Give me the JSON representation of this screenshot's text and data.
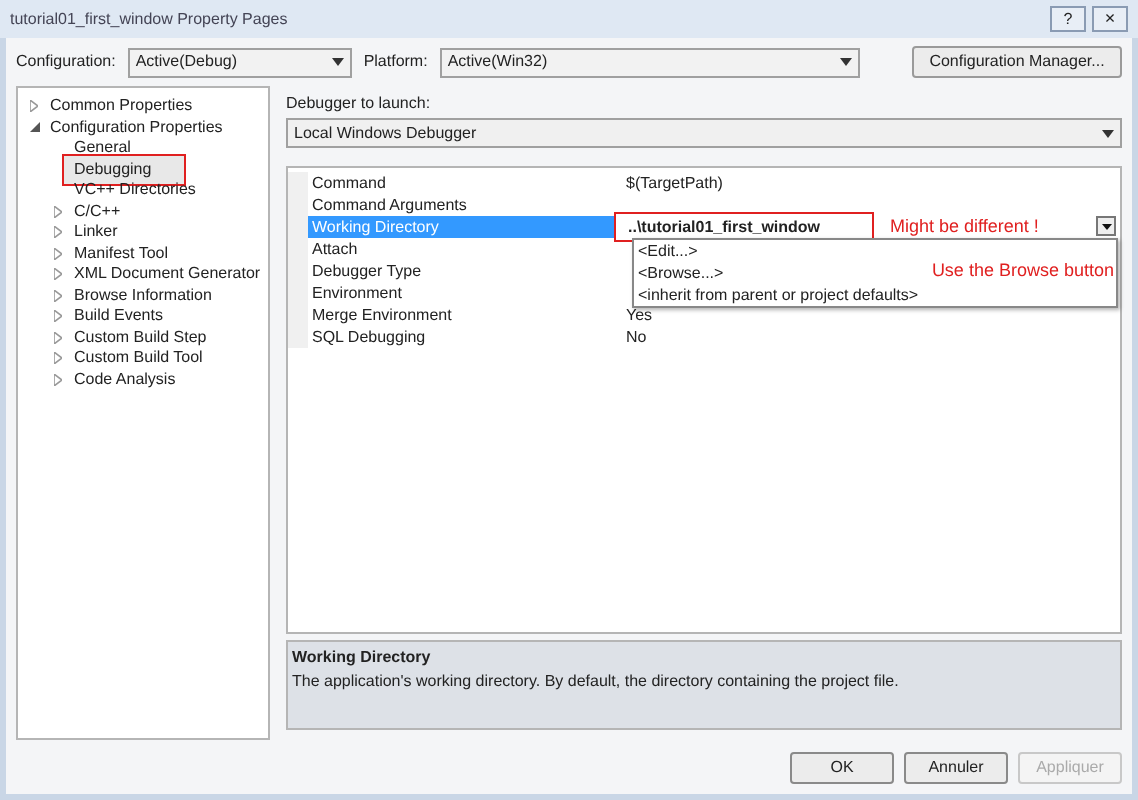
{
  "window": {
    "title": "tutorial01_first_window Property Pages",
    "help": "?",
    "close": "×"
  },
  "configuration": {
    "label": "Configuration:",
    "value": "Active(Debug)"
  },
  "platform": {
    "label": "Platform:",
    "value": "Active(Win32)"
  },
  "config_manager_button": "Configuration Manager...",
  "tree": [
    {
      "label": "Common Properties",
      "kind": "node",
      "expanded": false,
      "selected": false,
      "marked": false
    },
    {
      "label": "Configuration Properties",
      "kind": "node",
      "expanded": true,
      "selected": false,
      "marked": false,
      "children": [
        {
          "label": "General",
          "kind": "leaf",
          "selected": false,
          "marked": false
        },
        {
          "label": "Debugging",
          "kind": "leaf",
          "selected": true,
          "marked": true
        },
        {
          "label": "VC++ Directories",
          "kind": "leaf",
          "selected": false,
          "marked": false
        },
        {
          "label": "C/C++",
          "kind": "node",
          "expanded": false,
          "selected": false,
          "marked": false
        },
        {
          "label": "Linker",
          "kind": "node",
          "expanded": false,
          "selected": false,
          "marked": false
        },
        {
          "label": "Manifest Tool",
          "kind": "node",
          "expanded": false,
          "selected": false,
          "marked": false
        },
        {
          "label": "XML Document Generator",
          "kind": "node",
          "expanded": false,
          "selected": false,
          "marked": false
        },
        {
          "label": "Browse Information",
          "kind": "node",
          "expanded": false,
          "selected": false,
          "marked": false
        },
        {
          "label": "Build Events",
          "kind": "node",
          "expanded": false,
          "selected": false,
          "marked": false
        },
        {
          "label": "Custom Build Step",
          "kind": "node",
          "expanded": false,
          "selected": false,
          "marked": false
        },
        {
          "label": "Custom Build Tool",
          "kind": "node",
          "expanded": false,
          "selected": false,
          "marked": false
        },
        {
          "label": "Code Analysis",
          "kind": "node",
          "expanded": false,
          "selected": false,
          "marked": false
        }
      ]
    }
  ],
  "debugger": {
    "label": "Debugger to launch:",
    "value": "Local Windows Debugger"
  },
  "grid": {
    "rows": [
      {
        "name": "Command",
        "value": "$(TargetPath)",
        "selected": false
      },
      {
        "name": "Command Arguments",
        "selected": false
      },
      {
        "name": "Working Directory",
        "selected": true,
        "editor": {
          "value": "..\\tutorial01_first_window",
          "marked": true,
          "options": [
            "<Edit...>",
            "<Browse...>",
            "<inherit from parent or project defaults>"
          ]
        }
      },
      {
        "name": "Attach",
        "selected": false
      },
      {
        "name": "Debugger Type",
        "selected": false
      },
      {
        "name": "Environment",
        "selected": false
      },
      {
        "name": "Merge Environment",
        "value": "Yes",
        "selected": false
      },
      {
        "name": "SQL Debugging",
        "value": "No",
        "selected": false
      }
    ]
  },
  "annotations": [
    "Might be different !",
    "Use the Browse button"
  ],
  "description": {
    "title": "Working Directory",
    "text": "The application's working directory. By default, the directory containing the project file."
  },
  "buttons": [
    {
      "label": "OK",
      "disabled": false
    },
    {
      "label": "Annuler",
      "disabled": false
    },
    {
      "label": "Appliquer",
      "disabled": true
    }
  ]
}
